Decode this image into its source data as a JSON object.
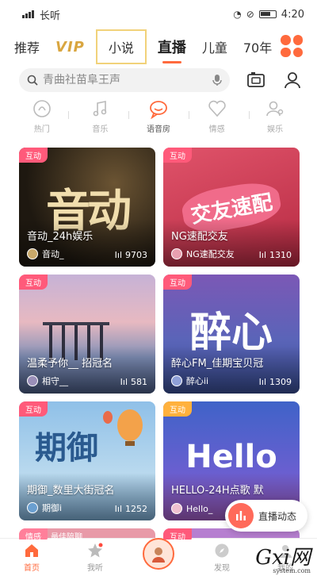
{
  "status_bar": {
    "carrier": "长听",
    "time": "4:20"
  },
  "category_tabs": [
    "推荐",
    "VIP",
    "小说",
    "直播",
    "儿童",
    "70年"
  ],
  "active_category": "直播",
  "search": {
    "placeholder": "青曲社苗阜王声"
  },
  "sub_tabs": [
    {
      "label": "热门",
      "icon": "flame-icon"
    },
    {
      "label": "音乐",
      "icon": "music-note-icon"
    },
    {
      "label": "语音房",
      "icon": "chat-bubble-icon"
    },
    {
      "label": "情感",
      "icon": "heart-icon"
    },
    {
      "label": "娱乐",
      "icon": "user-mic-icon"
    }
  ],
  "active_sub_tab": "语音房",
  "cards": [
    {
      "badge": "互动",
      "title": "音动_24h娱乐",
      "host": "音动_",
      "listeners": "9703",
      "art_text": "音动",
      "colors": [
        "#2a2217",
        "#5b4a2d"
      ]
    },
    {
      "badge": "互动",
      "title": "NG速配交友",
      "host": "NG速配交友",
      "listeners": "1310",
      "art_text": "交友速配",
      "colors": [
        "#c9344a",
        "#e86a7f"
      ]
    },
    {
      "badge": "互动",
      "title": "温柔予你__ 招冠名",
      "host": "相守__",
      "listeners": "581",
      "art_text": "",
      "colors": [
        "#d9b7c9",
        "#6f7fa8"
      ]
    },
    {
      "badge": "互动",
      "title": "醉心FM_佳期宝贝冠",
      "host": "醉心ii",
      "listeners": "1309",
      "art_text": "醉心",
      "colors": [
        "#7a4fb0",
        "#3a5fa0"
      ]
    },
    {
      "badge": "互动",
      "title": "期御_数里大街冠名",
      "host": "期御i",
      "listeners": "1252",
      "art_text": "期御",
      "colors": [
        "#6fa7d6",
        "#c8dff0"
      ]
    },
    {
      "badge": "互动",
      "title": "HELLO-24H点歌 默",
      "host": "Hello_",
      "listeners": "",
      "art_text": "Hello",
      "colors": [
        "#4a6fd0",
        "#8f5fd0"
      ]
    }
  ],
  "partial_cards": [
    {
      "badge": "情感",
      "title": "最佳陪聊"
    },
    {
      "badge": "互动"
    }
  ],
  "live_button": {
    "label": "直播动态"
  },
  "bottom_nav": [
    {
      "label": "首页",
      "icon": "home-icon"
    },
    {
      "label": "我听",
      "icon": "star-icon"
    },
    {
      "label": "",
      "icon": "center-avatar-icon"
    },
    {
      "label": "发现",
      "icon": "compass-icon"
    },
    {
      "label": "我的",
      "icon": "profile-icon"
    }
  ],
  "active_nav": "首页",
  "watermark": {
    "main": "Gxi网",
    "sub": "system.com"
  },
  "colors": {
    "accent": "#ff6a3d",
    "badge": "#ff5a7a",
    "vip": "#d9a640"
  }
}
